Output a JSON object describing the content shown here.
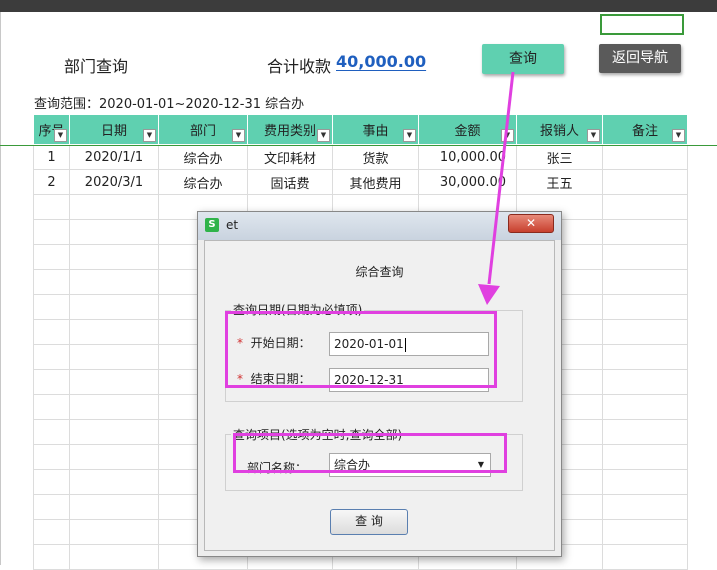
{
  "sheet": {
    "title": "部门查询",
    "total_label": "合计收款",
    "total_value": "40,000.00",
    "query_button": "查询",
    "nav_button": "返回导航",
    "range_text": "查询范围：2020-01-01~2020-12-31 综合办",
    "columns": [
      "序号",
      "日期",
      "部门",
      "费用类别",
      "事由",
      "金额",
      "报销人",
      "备注"
    ],
    "rows": [
      [
        "1",
        "2020/1/1",
        "综合办",
        "文印耗材",
        "货款",
        "10,000.00",
        "张三",
        ""
      ],
      [
        "2",
        "2020/3/1",
        "综合办",
        "固话费",
        "其他费用",
        "30,000.00",
        "王五",
        ""
      ]
    ],
    "dropdown_glyph": "▼",
    "accent_color": "#5fd0b0"
  },
  "dialog": {
    "app_icon": "S",
    "caption": "et",
    "close_glyph": "✕",
    "heading": "综合查询",
    "date_group_label": "查询日期(日期为必填项)",
    "start_label": "开始日期：",
    "start_value": "2020-01-01",
    "end_label": "结束日期：",
    "end_value": "2020-12-31",
    "required_mark": "*",
    "item_group_label": "查询项目(选项为空时,查询全部)",
    "dept_label": "部门名称：",
    "dept_value": "综合办",
    "select_arrow": "▼",
    "query_button": "查 询",
    "highlight_color": "#e040e0"
  }
}
